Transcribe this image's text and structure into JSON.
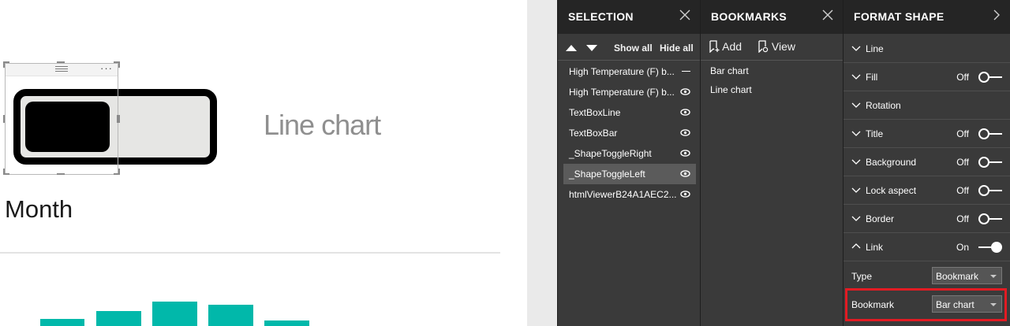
{
  "canvas": {
    "line_chart_text": "Line chart",
    "month_text": "Month",
    "frame_more": "···",
    "bar_color": "#01b8aa"
  },
  "selection": {
    "title": "SELECTION",
    "show_all": "Show all",
    "hide_all": "Hide all",
    "items": [
      {
        "label": "High Temperature (F) b...",
        "visibility": "hidden"
      },
      {
        "label": "High Temperature (F) b...",
        "visibility": "visible"
      },
      {
        "label": "TextBoxLine",
        "visibility": "visible"
      },
      {
        "label": "TextBoxBar",
        "visibility": "visible"
      },
      {
        "label": "_ShapeToggleRight",
        "visibility": "visible"
      },
      {
        "label": "_ShapeToggleLeft",
        "visibility": "visible",
        "selected": true
      },
      {
        "label": "htmlViewerB24A1AEC2...",
        "visibility": "visible"
      }
    ]
  },
  "bookmarks": {
    "title": "BOOKMARKS",
    "add_label": "Add",
    "view_label": "View",
    "items": [
      "Bar chart",
      "Line chart"
    ]
  },
  "format": {
    "title": "FORMAT SHAPE",
    "sections": [
      {
        "label": "Line"
      },
      {
        "label": "Fill",
        "state": "Off"
      },
      {
        "label": "Rotation"
      },
      {
        "label": "Title",
        "state": "Off"
      },
      {
        "label": "Background",
        "state": "Off"
      },
      {
        "label": "Lock aspect",
        "state": "Off"
      },
      {
        "label": "Border",
        "state": "Off"
      },
      {
        "label": "Link",
        "state": "On",
        "expanded": true
      }
    ],
    "type_label": "Type",
    "type_value": "Bookmark",
    "bookmark_label": "Bookmark",
    "bookmark_value": "Bar chart",
    "highlight_color": "#e21b23"
  }
}
